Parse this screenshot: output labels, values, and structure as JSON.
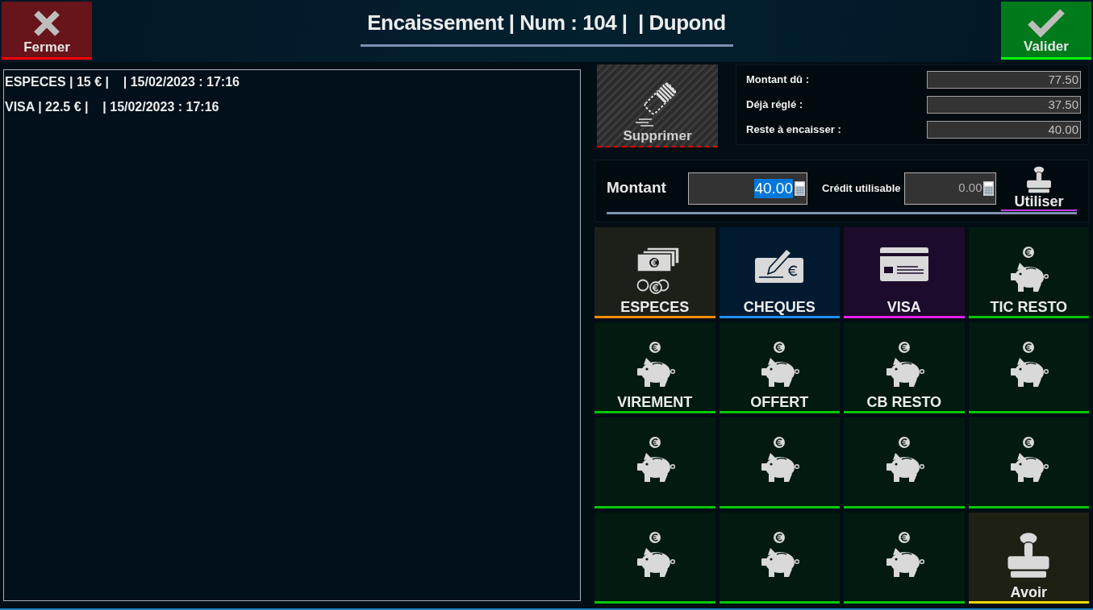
{
  "header": {
    "close_button": {
      "label": "Fermer"
    },
    "title": "Encaissement | Num : 104 |  | Dupond",
    "validate_button": {
      "label": "Valider"
    }
  },
  "payment_list": [
    {
      "text": "ESPECES | 15 € |    | 15/02/2023 : 17:16"
    },
    {
      "text": "VISA | 22.5 € |    | 15/02/2023 : 17:16"
    }
  ],
  "delete_button": {
    "label": "Supprimer",
    "disabled": true
  },
  "totals": [
    {
      "label": "Montant dû :",
      "value": "77.50"
    },
    {
      "label": "Déjà réglé :",
      "value": "37.50"
    },
    {
      "label": "Reste à encaisser :",
      "value": "40.00"
    }
  ],
  "amount": {
    "label": "Montant",
    "value": "40.00",
    "highlighted": true
  },
  "credit": {
    "label": "Crédit utilisable",
    "value": "0.00"
  },
  "use_button": {
    "label": "Utiliser"
  },
  "payment_methods": [
    {
      "label": "ESPECES",
      "kind": "cash",
      "color": "#ff8c00"
    },
    {
      "label": "CHEQUES",
      "kind": "cheque",
      "color": "#1e90ff"
    },
    {
      "label": "VISA",
      "kind": "card",
      "color": "#e61ee6"
    },
    {
      "label": "TIC RESTO",
      "kind": "piggy",
      "color": "#00c800"
    },
    {
      "label": "VIREMENT",
      "kind": "piggy",
      "color": "#00c800"
    },
    {
      "label": "OFFERT",
      "kind": "piggy",
      "color": "#00c800"
    },
    {
      "label": "CB RESTO",
      "kind": "piggy",
      "color": "#00c800"
    },
    {
      "kind": "piggy",
      "color": "#00c800"
    },
    {
      "kind": "piggy",
      "color": "#00c800"
    },
    {
      "kind": "piggy",
      "color": "#00c800"
    },
    {
      "kind": "piggy",
      "color": "#00c800"
    },
    {
      "kind": "piggy",
      "color": "#00c800"
    },
    {
      "kind": "piggy",
      "color": "#00c800"
    },
    {
      "kind": "piggy",
      "color": "#00c800"
    },
    {
      "kind": "piggy",
      "color": "#00c800"
    },
    {
      "label": "Avoir",
      "kind": "stamp",
      "color": "#ffd800"
    }
  ]
}
